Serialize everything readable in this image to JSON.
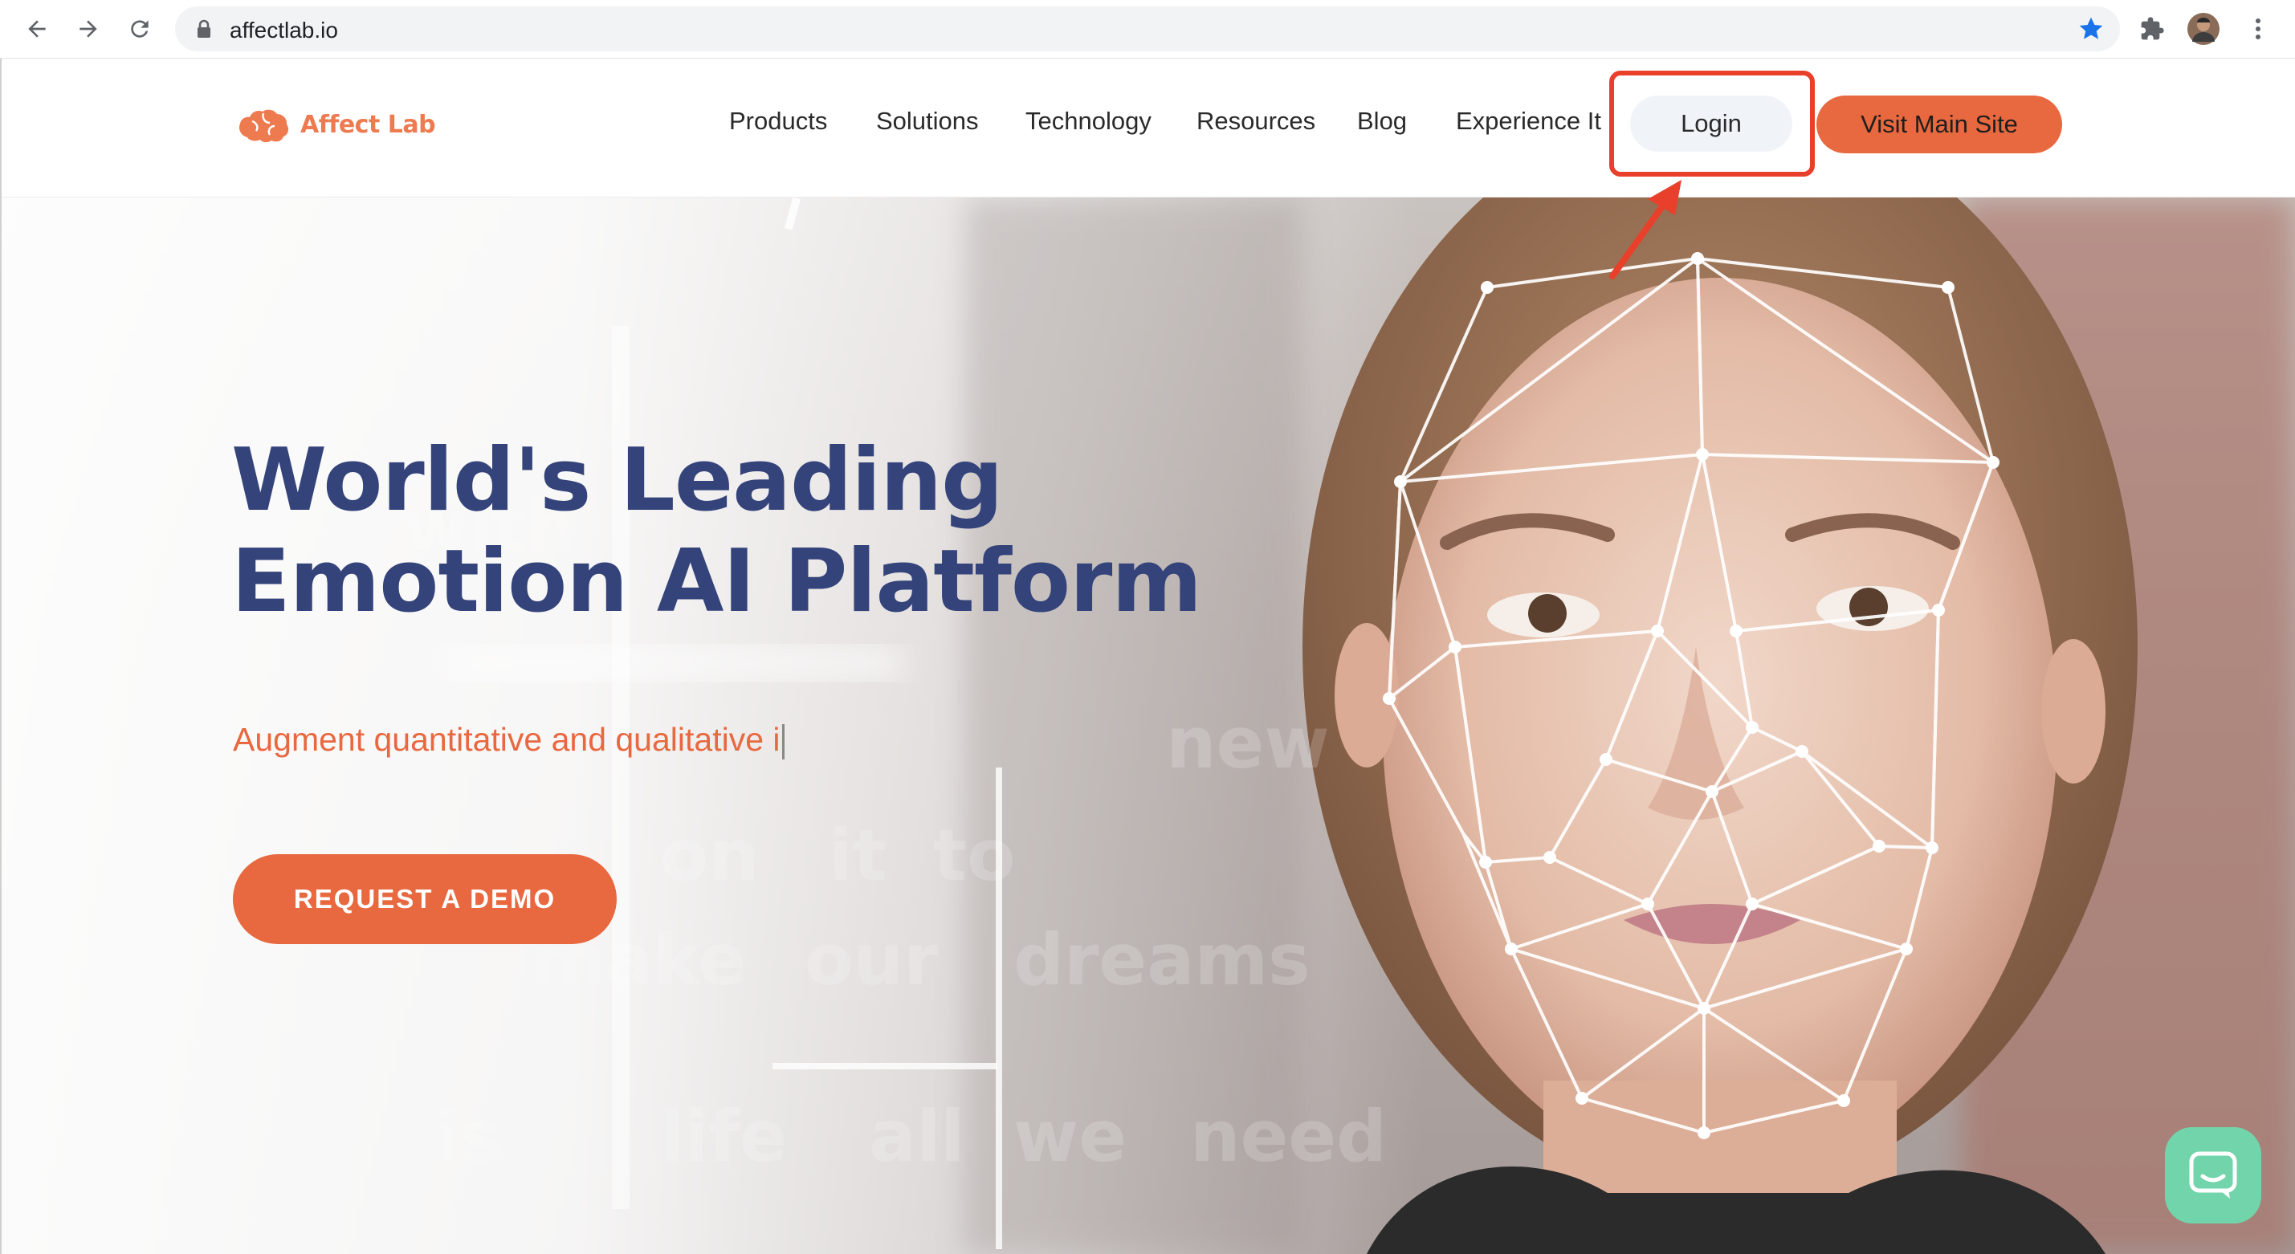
{
  "browser": {
    "url": "affectlab.io",
    "nav_icons": [
      "back-arrow-icon",
      "forward-arrow-icon",
      "reload-icon"
    ],
    "right_icons": [
      "bookmark-star-icon",
      "extensions-puzzle-icon",
      "profile-avatar",
      "more-vert-icon"
    ]
  },
  "header": {
    "logo_text": "Affect Lab",
    "nav": [
      "Products",
      "Solutions",
      "Technology",
      "Resources",
      "Blog",
      "Experience It"
    ],
    "login_label": "Login",
    "visit_label": "Visit Main Site"
  },
  "hero": {
    "title_line1": "World's Leading",
    "title_line2": "Emotion AI Platform",
    "subtitle": "Augment quantitative and qualitative i",
    "cta_label": "REQUEST A DEMO"
  },
  "colors": {
    "brand_orange": "#e8683f",
    "title_navy": "#34437a",
    "highlight_red": "#e8402a",
    "chat_green": "#72d4aa"
  }
}
